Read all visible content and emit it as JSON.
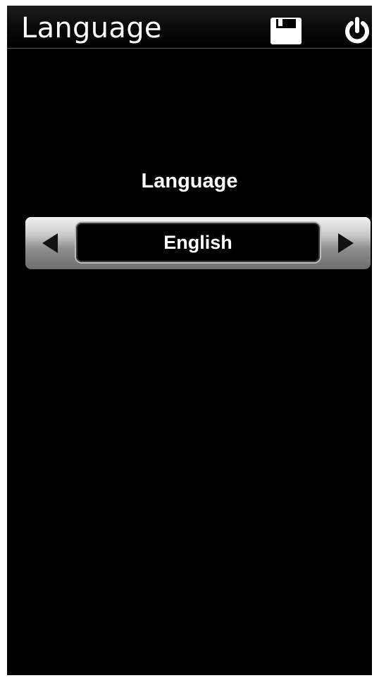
{
  "header": {
    "title": "Language",
    "save_icon": "floppy-disk-icon",
    "power_icon": "power-icon"
  },
  "language_setting": {
    "label": "Language",
    "value": "English",
    "prev_icon": "triangle-left-icon",
    "next_icon": "triangle-right-icon"
  },
  "colors": {
    "background": "#000000",
    "text": "#ffffff",
    "selector_light": "#f2f2f2",
    "selector_dark": "#6d6d6d"
  }
}
